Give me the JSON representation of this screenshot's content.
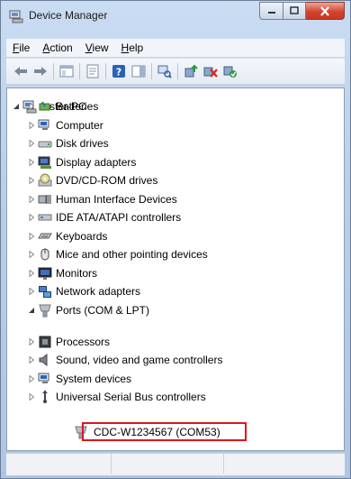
{
  "window": {
    "title": "Device Manager"
  },
  "menu": [
    {
      "label": "File",
      "u": "F",
      "rest": "ile"
    },
    {
      "label": "Action",
      "u": "A",
      "rest": "ction"
    },
    {
      "label": "View",
      "u": "V",
      "rest": "iew"
    },
    {
      "label": "Help",
      "u": "H",
      "rest": "elp"
    }
  ],
  "toolbar": {
    "buttons": [
      "back-icon",
      "forward-icon",
      "properties-icon",
      "update-icon",
      "help-icon",
      "show-hidden-icon",
      "scan-hardware-icon",
      "update-driver-icon",
      "uninstall-icon",
      "enable-icon"
    ]
  },
  "tree": {
    "root": "tester-PC",
    "categories": [
      {
        "label": "Batteries",
        "icon": "battery-icon",
        "expanded": false
      },
      {
        "label": "Computer",
        "icon": "computer-icon",
        "expanded": false
      },
      {
        "label": "Disk drives",
        "icon": "disk-drive-icon",
        "expanded": false
      },
      {
        "label": "Display adapters",
        "icon": "display-adapter-icon",
        "expanded": false
      },
      {
        "label": "DVD/CD-ROM drives",
        "icon": "dvd-drive-icon",
        "expanded": false
      },
      {
        "label": "Human Interface Devices",
        "icon": "hid-icon",
        "expanded": false
      },
      {
        "label": "IDE ATA/ATAPI controllers",
        "icon": "ide-controller-icon",
        "expanded": false
      },
      {
        "label": "Keyboards",
        "icon": "keyboard-icon",
        "expanded": false
      },
      {
        "label": "Mice and other pointing devices",
        "icon": "mouse-icon",
        "expanded": false
      },
      {
        "label": "Monitors",
        "icon": "monitor-icon",
        "expanded": false
      },
      {
        "label": "Network adapters",
        "icon": "network-adapter-icon",
        "expanded": false
      },
      {
        "label": "Ports (COM & LPT)",
        "icon": "port-icon",
        "expanded": true
      },
      {
        "label": "Processors",
        "icon": "processor-icon",
        "expanded": false
      },
      {
        "label": "Sound, video and game controllers",
        "icon": "sound-icon",
        "expanded": false
      },
      {
        "label": "System devices",
        "icon": "system-device-icon",
        "expanded": false
      },
      {
        "label": "Universal Serial Bus controllers",
        "icon": "usb-icon",
        "expanded": false
      }
    ],
    "port_child": "CDC-W1234567 (COM53)"
  },
  "colors": {
    "highlight_border": "#e0141e",
    "close_button": "#d3452f"
  }
}
